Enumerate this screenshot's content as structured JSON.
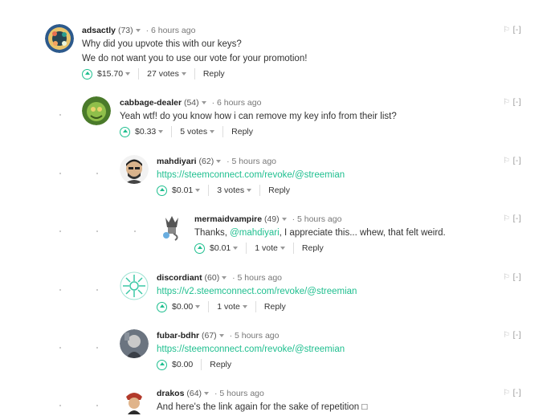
{
  "comments": [
    {
      "author": "adsactly",
      "rep": "(73)",
      "time": "· 6 hours ago",
      "lines": [
        "Why did you upvote this with our keys?",
        "We do not want you to use our vote for your promotion!"
      ],
      "payout": "$15.70",
      "votes": "27 votes",
      "reply": "Reply",
      "avatar": "adsactly-avatar"
    },
    {
      "author": "cabbage-dealer",
      "rep": "(54)",
      "time": "· 6 hours ago",
      "lines": [
        "Yeah wtf! do you know how i can remove my key info from their list?"
      ],
      "payout": "$0.33",
      "votes": "5 votes",
      "reply": "Reply"
    },
    {
      "author": "mahdiyari",
      "rep": "(62)",
      "time": "· 5 hours ago",
      "link": "https://steemconnect.com/revoke/@streemian",
      "payout": "$0.01",
      "votes": "3 votes",
      "reply": "Reply"
    },
    {
      "author": "mermaidvampire",
      "rep": "(49)",
      "time": "· 5 hours ago",
      "text_pre": "Thanks, ",
      "mention": "@mahdiyari",
      "text_post": ", I appreciate this... whew, that felt weird.",
      "payout": "$0.01",
      "votes": "1 vote",
      "reply": "Reply"
    },
    {
      "author": "discordiant",
      "rep": "(60)",
      "time": "· 5 hours ago",
      "link": "https://v2.steemconnect.com/revoke/@streemian",
      "payout": "$0.00",
      "votes": "1 vote",
      "reply": "Reply"
    },
    {
      "author": "fubar-bdhr",
      "rep": "(67)",
      "time": "· 5 hours ago",
      "link": "https://steemconnect.com/revoke/@streemian",
      "payout": "$0.00",
      "reply": "Reply"
    },
    {
      "author": "drakos",
      "rep": "(64)",
      "time": "· 5 hours ago",
      "text": "And here's the link again for the sake of repetition □"
    }
  ],
  "ui": {
    "flag_glyph": "⚐",
    "collapse": "[-]"
  },
  "colors": {
    "accent": "#1fbf8f",
    "text": "#333333",
    "muted": "#777777"
  }
}
